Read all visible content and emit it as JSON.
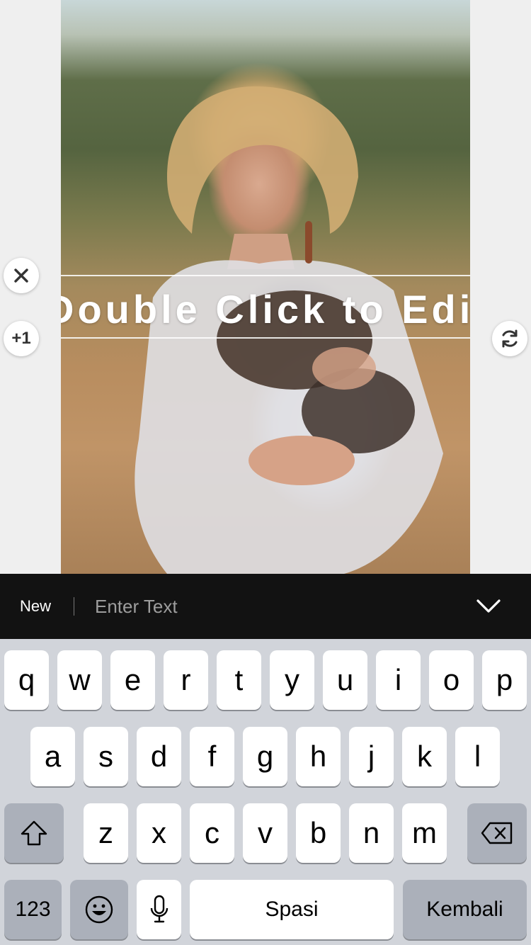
{
  "canvas": {
    "overlay_text": "Double Click to Edit",
    "buttons": {
      "close_icon": "close-icon",
      "plus_one_label": "+1",
      "rotate_icon": "rotate-icon"
    }
  },
  "input_bar": {
    "new_label": "New",
    "text_placeholder": "Enter Text",
    "text_value": "",
    "collapse_icon": "chevron-down-icon"
  },
  "keyboard": {
    "row1": [
      "q",
      "w",
      "e",
      "r",
      "t",
      "y",
      "u",
      "i",
      "o",
      "p"
    ],
    "row2": [
      "a",
      "s",
      "d",
      "f",
      "g",
      "h",
      "j",
      "k",
      "l"
    ],
    "row3": [
      "z",
      "x",
      "c",
      "v",
      "b",
      "n",
      "m"
    ],
    "shift_icon": "shift-icon",
    "backspace_icon": "backspace-icon",
    "numbers_label": "123",
    "emoji_icon": "emoji-icon",
    "mic_icon": "microphone-icon",
    "space_label": "Spasi",
    "return_label": "Kembali"
  }
}
